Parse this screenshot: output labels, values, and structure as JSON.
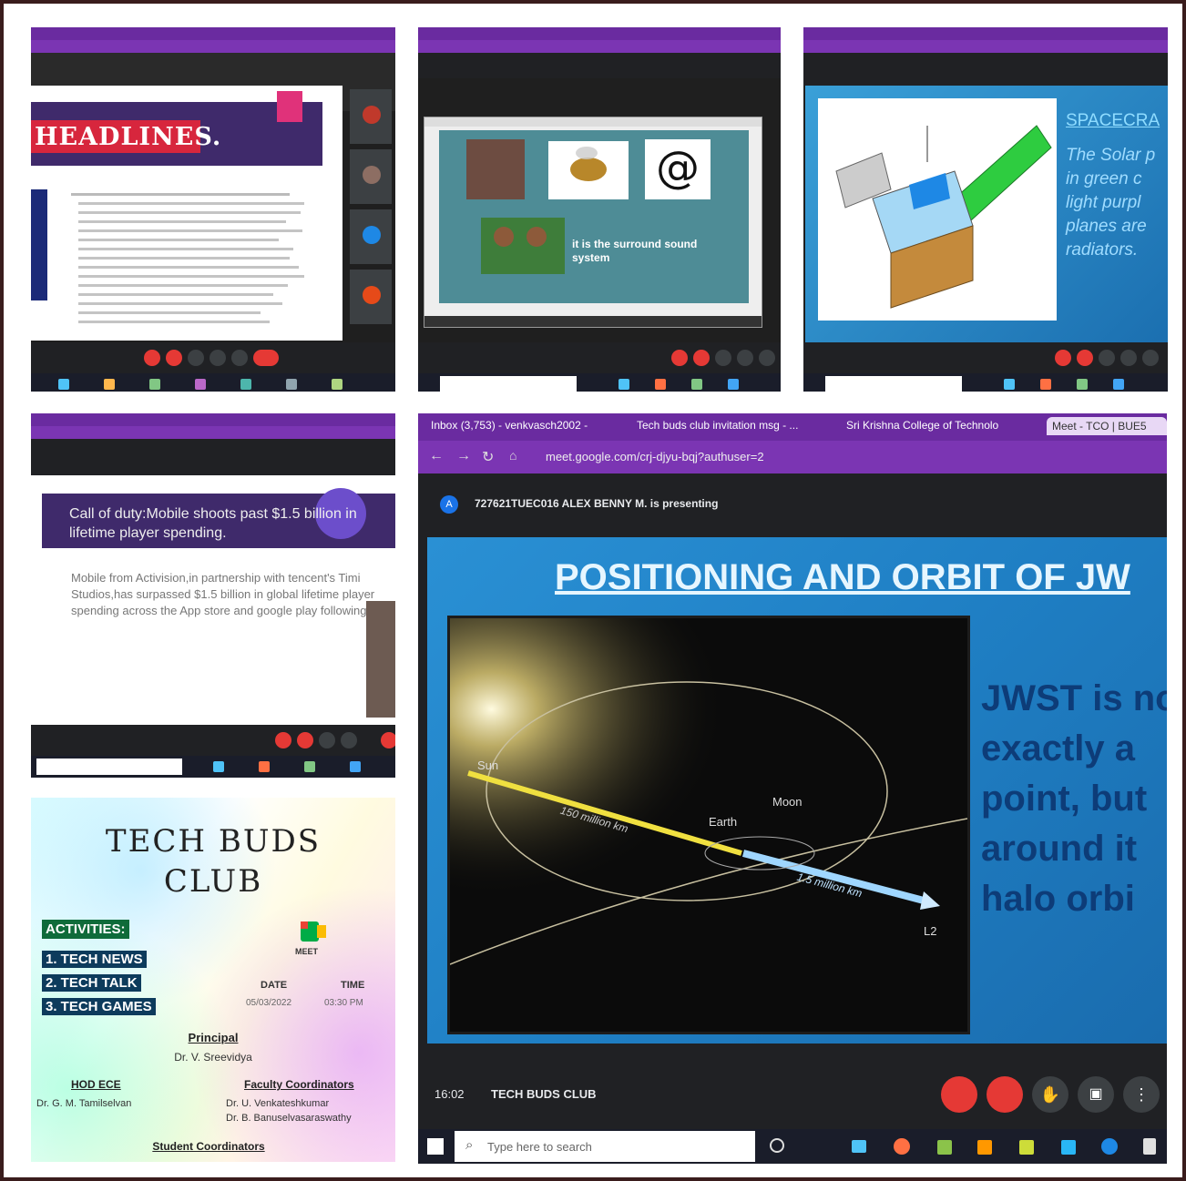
{
  "panels": {
    "headlines": {
      "title": "HEADLINES."
    },
    "surround": {
      "caption": "it is the surround sound system"
    },
    "spacecraft": {
      "title": "SPACECRA",
      "lines": [
        "The Solar p",
        "in green c",
        "light purpl",
        "planes are",
        "radiators."
      ]
    },
    "cod": {
      "heading": "Call of duty:Mobile shoots past $1.5 billion in lifetime player spending.",
      "bullet": "Mobile from Activision,in partnership with tencent's Timi Studios,has surpassed $1.5 billion in global lifetime player spending across the App store and google play following."
    },
    "poster": {
      "title1": "TECH BUDS",
      "title2": "CLUB",
      "activities_label": "ACTIVITIES:",
      "activities": [
        "1. TECH NEWS",
        "2. TECH TALK",
        "3. TECH GAMES"
      ],
      "meet_label": "MEET",
      "date_label": "DATE",
      "date_value": "05/03/2022",
      "time_label": "TIME",
      "time_value": "03:30 PM",
      "principal_label": "Principal",
      "principal_name": "Dr. V. Sreevidya",
      "hod_label": "HOD ECE",
      "hod_name": "Dr. G. M. Tamilselvan",
      "faculty_label": "Faculty Coordinators",
      "faculty_names": [
        "Dr. U. Venkateshkumar",
        "Dr. B. Banuselvasaraswathy"
      ],
      "student_label": "Student Coordinators"
    },
    "main": {
      "tabs": [
        "Inbox (3,753) - venkvasch2002 -",
        "Tech buds club invitation msg - ...",
        "Sri Krishna College of Technolo",
        "Meet - TCO | BUE5"
      ],
      "url": "meet.google.com/crj-djyu-bqj?authuser=2",
      "presenting": "727621TUEC016 ALEX BENNY M. is presenting",
      "presenter_initial": "A",
      "slide_title": "POSITIONING AND ORBIT OF JW",
      "diagram_labels": {
        "sun": "Sun",
        "earth": "Earth",
        "moon": "Moon",
        "l2": "L2",
        "d1": "150 million km",
        "d2": "1.5 million km"
      },
      "side_text": [
        "JWST is no",
        "exactly a",
        "point, but",
        "around it",
        "halo orbi"
      ],
      "time": "16:02",
      "meeting_name": "TECH BUDS CLUB",
      "search_placeholder": "Type here to search"
    }
  },
  "colors": {
    "chrome": "#6a2ba0",
    "meet_bg": "#202124",
    "slide_blue": "#1f7fc4",
    "end_call": "#e53935"
  }
}
